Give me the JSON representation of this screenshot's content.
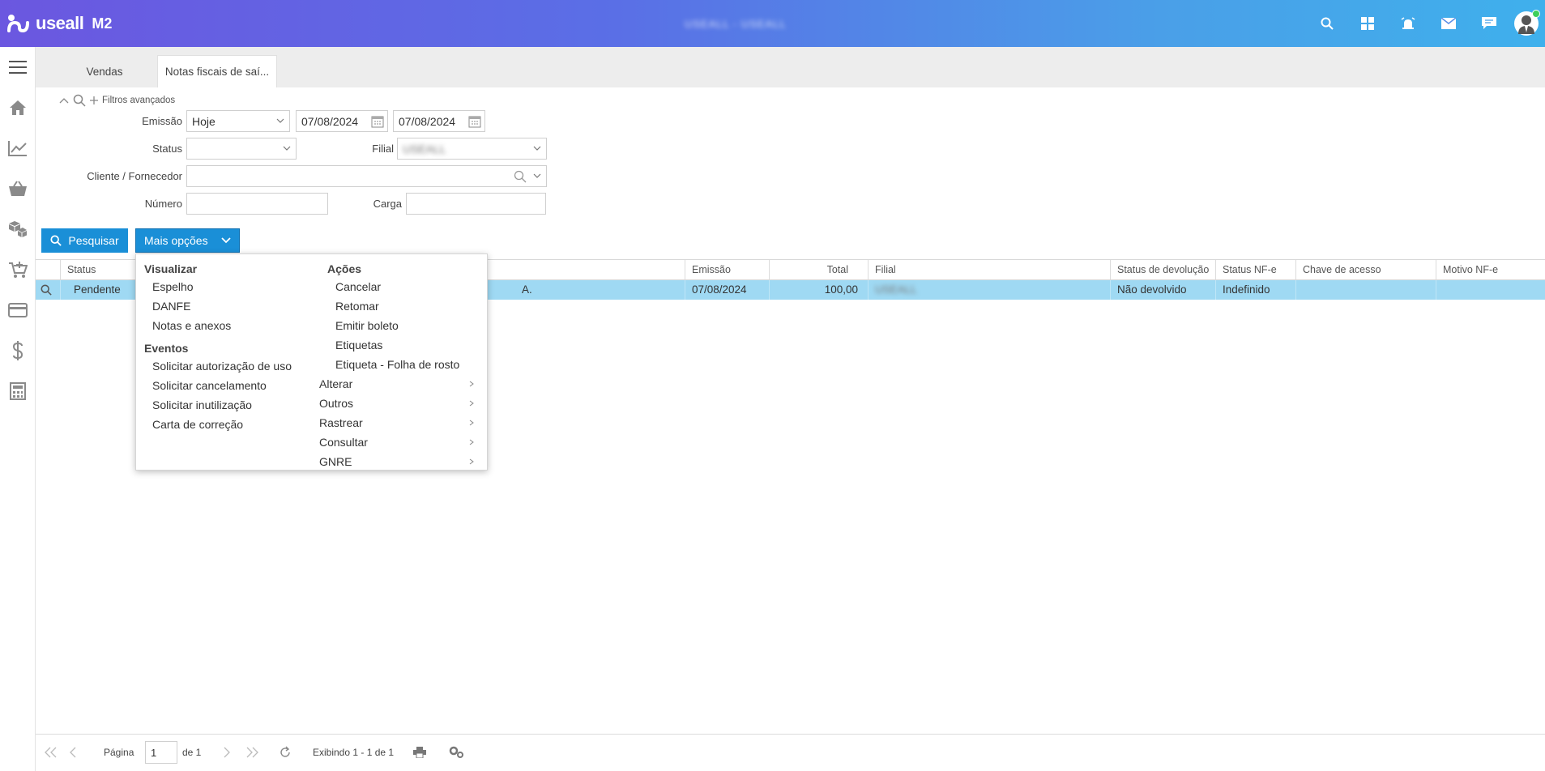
{
  "app": {
    "logo_text": "useall",
    "logo_sub": "M2",
    "company": "USEALL - USEALL"
  },
  "tabs": [
    {
      "label": "Vendas"
    },
    {
      "label": "Notas fiscais de saí..."
    }
  ],
  "filters": {
    "toggle_label": "Filtros avançados",
    "emissao": {
      "label": "Emissão",
      "value": "Hoje",
      "from": "07/08/2024",
      "to": "07/08/2024"
    },
    "status": {
      "label": "Status",
      "value": ""
    },
    "filial": {
      "label": "Filial",
      "value": "USEALL"
    },
    "cliente": {
      "label": "Cliente / Fornecedor",
      "value": ""
    },
    "numero": {
      "label": "Número",
      "value": ""
    },
    "carga": {
      "label": "Carga",
      "value": ""
    }
  },
  "buttons": {
    "search": "Pesquisar",
    "more": "Mais opções"
  },
  "grid": {
    "columns": [
      "Status",
      "Emissão",
      "Total",
      "Filial",
      "Status de devolução",
      "Status NF-e",
      "Chave de acesso",
      "Motivo NF-e"
    ],
    "rows": [
      {
        "status": "Pendente",
        "client_tail": "A.",
        "emissao": "07/08/2024",
        "total": "100,00",
        "filial": "USEALL",
        "status_devolucao": "Não devolvido",
        "status_nfe": "Indefinido",
        "chave": "",
        "motivo": ""
      }
    ]
  },
  "menu": {
    "visualizar": {
      "title": "Visualizar",
      "items": [
        "Espelho",
        "DANFE",
        "Notas e anexos"
      ]
    },
    "eventos": {
      "title": "Eventos",
      "items": [
        "Solicitar autorização de uso",
        "Solicitar cancelamento",
        "Solicitar inutilização",
        "Carta de correção"
      ]
    },
    "acoes": {
      "title": "Ações",
      "items": [
        "Cancelar",
        "Retomar",
        "Emitir boleto",
        "Etiquetas",
        "Etiqueta - Folha de rosto"
      ]
    },
    "submenus": [
      "Alterar",
      "Outros",
      "Rastrear",
      "Consultar",
      "GNRE"
    ]
  },
  "pager": {
    "page_label": "Página",
    "page": "1",
    "of_label": "de 1",
    "showing": "Exibindo 1 - 1 de 1"
  },
  "icons": {
    "top": [
      "search-icon",
      "apps-icon",
      "alarm-icon",
      "mail-icon",
      "chat-icon"
    ],
    "side": [
      "menu-icon",
      "home-icon",
      "chart-icon",
      "basket-icon",
      "boxes-icon",
      "cart-icon",
      "card-icon",
      "dollar-icon",
      "calculator-icon"
    ]
  },
  "colors": {
    "primary": "#1a8fd7",
    "row_selected": "#9fd9f3",
    "online": "#3ecf5c"
  }
}
